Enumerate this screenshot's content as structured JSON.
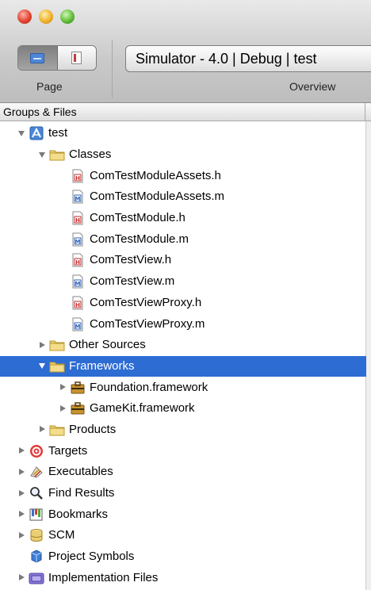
{
  "toolbar": {
    "page_label": "Page",
    "overview_label": "Overview",
    "overview_value": "Simulator - 4.0 | Debug | test"
  },
  "sidebar": {
    "header": "Groups & Files",
    "items": [
      {
        "label": "test",
        "depth": 0,
        "icon": "project-icon",
        "disclosure": "expanded"
      },
      {
        "label": "Classes",
        "depth": 1,
        "icon": "folder-icon",
        "disclosure": "expanded"
      },
      {
        "label": "ComTestModuleAssets.h",
        "depth": 2,
        "icon": "header-file-icon",
        "disclosure": "none"
      },
      {
        "label": "ComTestModuleAssets.m",
        "depth": 2,
        "icon": "source-file-icon",
        "disclosure": "none"
      },
      {
        "label": "ComTestModule.h",
        "depth": 2,
        "icon": "header-file-icon",
        "disclosure": "none"
      },
      {
        "label": "ComTestModule.m",
        "depth": 2,
        "icon": "source-file-icon",
        "disclosure": "none"
      },
      {
        "label": "ComTestView.h",
        "depth": 2,
        "icon": "header-file-icon",
        "disclosure": "none"
      },
      {
        "label": "ComTestView.m",
        "depth": 2,
        "icon": "source-file-icon",
        "disclosure": "none"
      },
      {
        "label": "ComTestViewProxy.h",
        "depth": 2,
        "icon": "header-file-icon",
        "disclosure": "none"
      },
      {
        "label": "ComTestViewProxy.m",
        "depth": 2,
        "icon": "source-file-icon",
        "disclosure": "none"
      },
      {
        "label": "Other Sources",
        "depth": 1,
        "icon": "folder-icon",
        "disclosure": "collapsed"
      },
      {
        "label": "Frameworks",
        "depth": 1,
        "icon": "folder-icon",
        "disclosure": "expanded",
        "selected": true
      },
      {
        "label": "Foundation.framework",
        "depth": 2,
        "icon": "framework-icon",
        "disclosure": "collapsed"
      },
      {
        "label": "GameKit.framework",
        "depth": 2,
        "icon": "framework-icon",
        "disclosure": "collapsed"
      },
      {
        "label": "Products",
        "depth": 1,
        "icon": "folder-icon",
        "disclosure": "collapsed"
      },
      {
        "label": "Targets",
        "depth": 0,
        "icon": "target-icon",
        "disclosure": "collapsed"
      },
      {
        "label": "Executables",
        "depth": 0,
        "icon": "executables-icon",
        "disclosure": "collapsed"
      },
      {
        "label": "Find Results",
        "depth": 0,
        "icon": "magnifier-icon",
        "disclosure": "collapsed"
      },
      {
        "label": "Bookmarks",
        "depth": 0,
        "icon": "bookmarks-icon",
        "disclosure": "collapsed"
      },
      {
        "label": "SCM",
        "depth": 0,
        "icon": "scm-icon",
        "disclosure": "collapsed"
      },
      {
        "label": "Project Symbols",
        "depth": 0,
        "icon": "project-symbols-icon",
        "disclosure": "none"
      },
      {
        "label": "Implementation Files",
        "depth": 0,
        "icon": "implementation-files-icon",
        "disclosure": "collapsed"
      }
    ]
  },
  "colors": {
    "selection": "#2d6cd3",
    "folder": "#e9cf74",
    "header_badge": "#c42a2a",
    "source_badge": "#2b5fb8"
  }
}
